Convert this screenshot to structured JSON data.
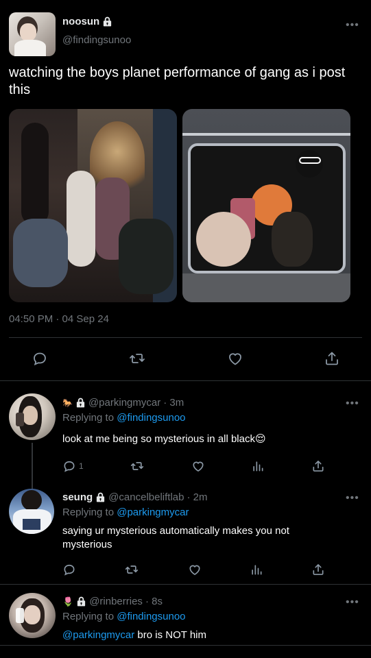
{
  "main_tweet": {
    "display_name": "noosun",
    "handle": "@findingsunoo",
    "text": "watching the boys planet performance of gang as i post this",
    "timestamp": "04:50 PM · 04 Sep 24",
    "more_label": "•••"
  },
  "replies": [
    {
      "display_name": "",
      "handle": "@parkingmycar",
      "time": "· 3m",
      "replying_prefix": "Replying to ",
      "replying_to": "@findingsunoo",
      "text": "look at me being so mysterious in all black😌",
      "reply_count": "1",
      "more_label": "•••"
    },
    {
      "display_name": "seung",
      "handle": "@cancelbeliftlab",
      "time": "· 2m",
      "replying_prefix": "Replying to ",
      "replying_to": "@parkingmycar",
      "text": "saying ur mysterious automatically makes you not mysterious",
      "more_label": "•••"
    },
    {
      "display_name": "",
      "handle": "@rinberries",
      "time": "· 8s",
      "replying_prefix": "Replying to ",
      "replying_to": "@findingsunoo",
      "text_mention": "@parkingmycar",
      "text_rest": " bro is NOT him",
      "more_label": "•••"
    }
  ],
  "colors": {
    "background": "#000000",
    "link": "#1d9bf0",
    "muted": "#71767b",
    "divider": "#2f3336"
  },
  "icons": [
    "lock-icon",
    "reply-icon",
    "retweet-icon",
    "like-icon",
    "share-icon",
    "views-icon",
    "more-icon"
  ]
}
